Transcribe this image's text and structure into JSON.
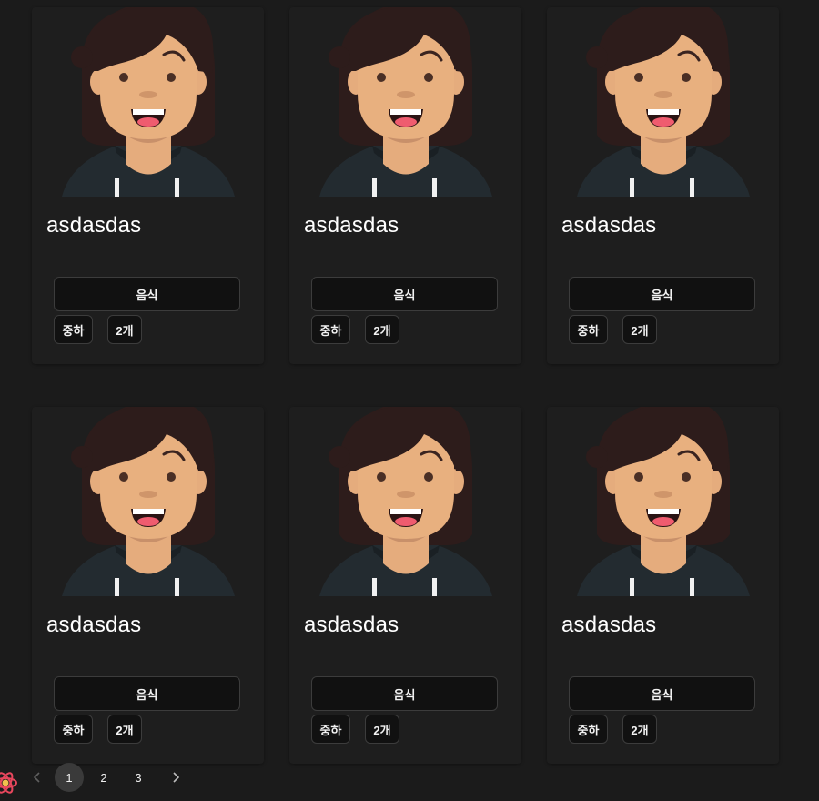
{
  "cards": [
    {
      "title": "asdasdas",
      "category": "음식",
      "level": "중하",
      "count": "2개"
    },
    {
      "title": "asdasdas",
      "category": "음식",
      "level": "중하",
      "count": "2개"
    },
    {
      "title": "asdasdas",
      "category": "음식",
      "level": "중하",
      "count": "2개"
    },
    {
      "title": "asdasdas",
      "category": "음식",
      "level": "중하",
      "count": "2개"
    },
    {
      "title": "asdasdas",
      "category": "음식",
      "level": "중하",
      "count": "2개"
    },
    {
      "title": "asdasdas",
      "category": "음식",
      "level": "중하",
      "count": "2개"
    }
  ],
  "pagination": {
    "pages": [
      "1",
      "2",
      "3"
    ],
    "current": "1",
    "prev_icon": "chevron-left-icon",
    "next_icon": "chevron-right-icon"
  },
  "dev_badge": {
    "icon": "react-logo-icon"
  },
  "colors": {
    "background": "#1b1b1b",
    "card": "#1e1e1e",
    "button": "#111111",
    "button_border": "#3c3c3c",
    "active_page": "#3a3a3a"
  }
}
